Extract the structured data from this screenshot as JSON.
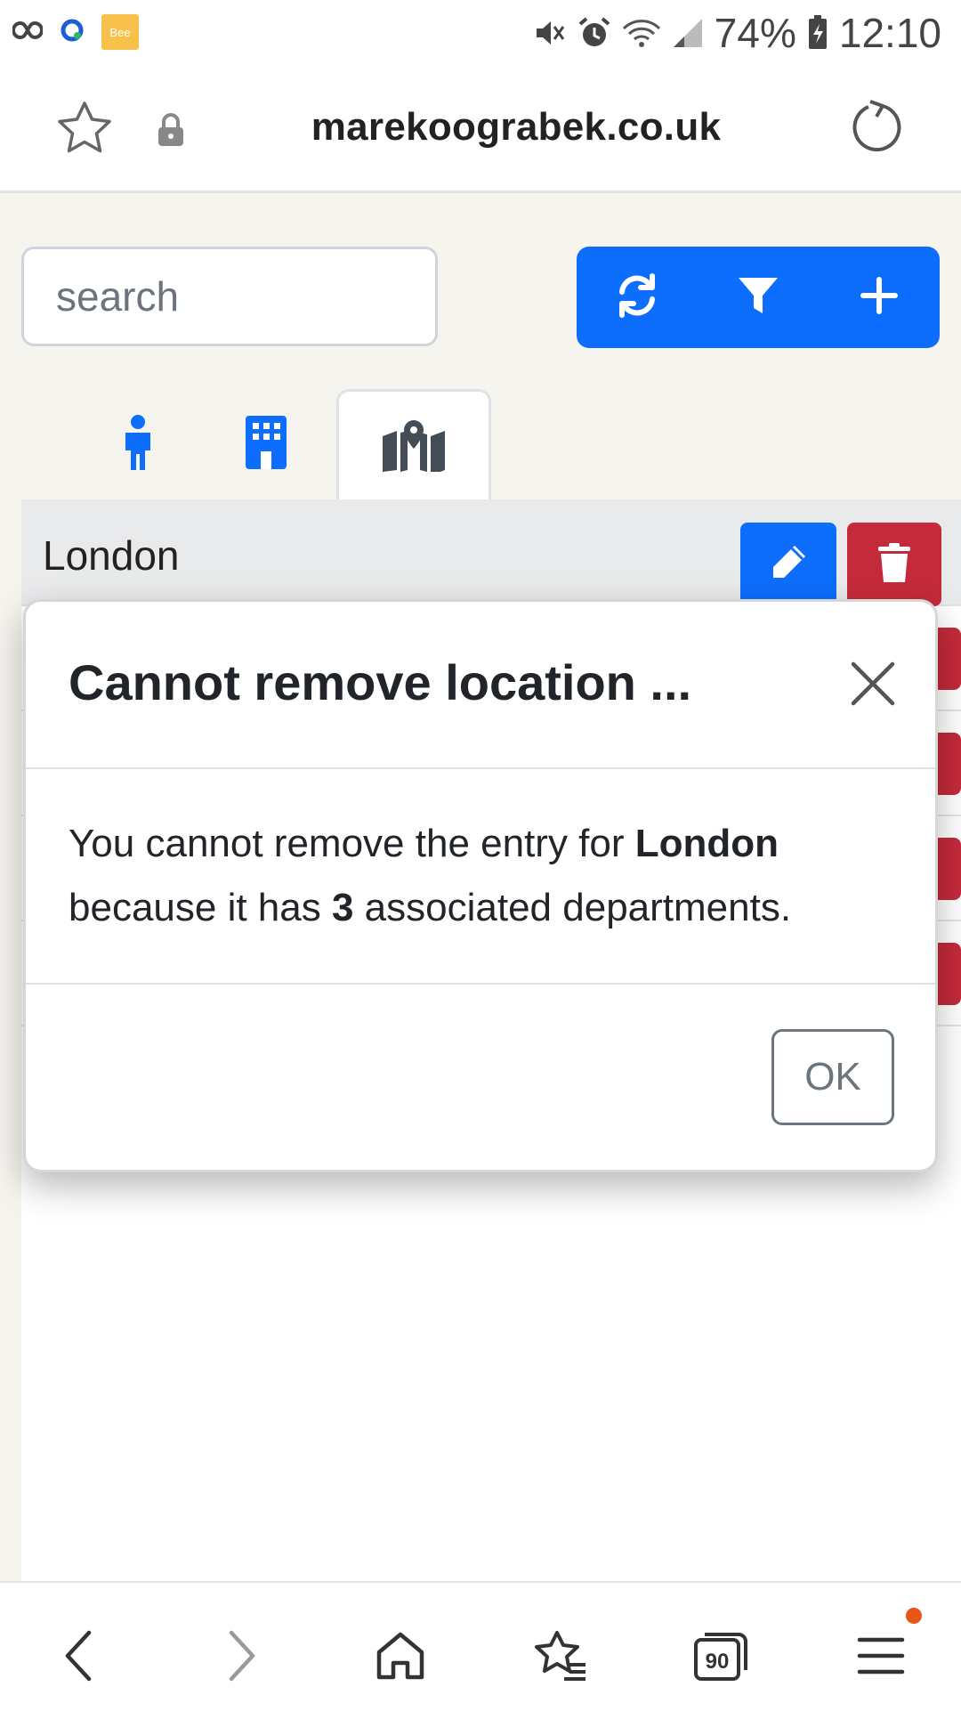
{
  "status_bar": {
    "battery": "74%",
    "time": "12:10",
    "bee_label": "Bee",
    "icons": [
      "infinity-icon",
      "cloud-sync-icon",
      "bee-app-icon",
      "mute-icon",
      "alarm-icon",
      "wifi-icon",
      "signal-icon",
      "battery-charging-icon"
    ]
  },
  "browser": {
    "url": "marekoograbek.co.uk",
    "icons": [
      "star-icon",
      "lock-icon",
      "reload-icon"
    ]
  },
  "toolbar": {
    "search_placeholder": "search",
    "buttons": [
      "refresh-icon",
      "filter-icon",
      "plus-icon"
    ],
    "accent_color": "#0d6efd"
  },
  "tabs": [
    {
      "icon": "person-icon",
      "active": false
    },
    {
      "icon": "building-icon",
      "active": false
    },
    {
      "icon": "map-location-icon",
      "active": true
    }
  ],
  "list": {
    "rows": [
      {
        "name": "London"
      }
    ],
    "danger_color": "#c42a3a"
  },
  "modal": {
    "title": "Cannot remove location ...",
    "body_prefix": "You cannot remove the entry for ",
    "location_name": "London",
    "body_middle": " because it has ",
    "department_count": "3",
    "body_suffix": " associated departments.",
    "ok_label": "OK"
  },
  "bottom_nav": {
    "tab_count": "90",
    "icons": [
      "back-icon",
      "forward-icon",
      "home-icon",
      "bookmarks-icon",
      "tabs-icon",
      "menu-icon"
    ]
  }
}
